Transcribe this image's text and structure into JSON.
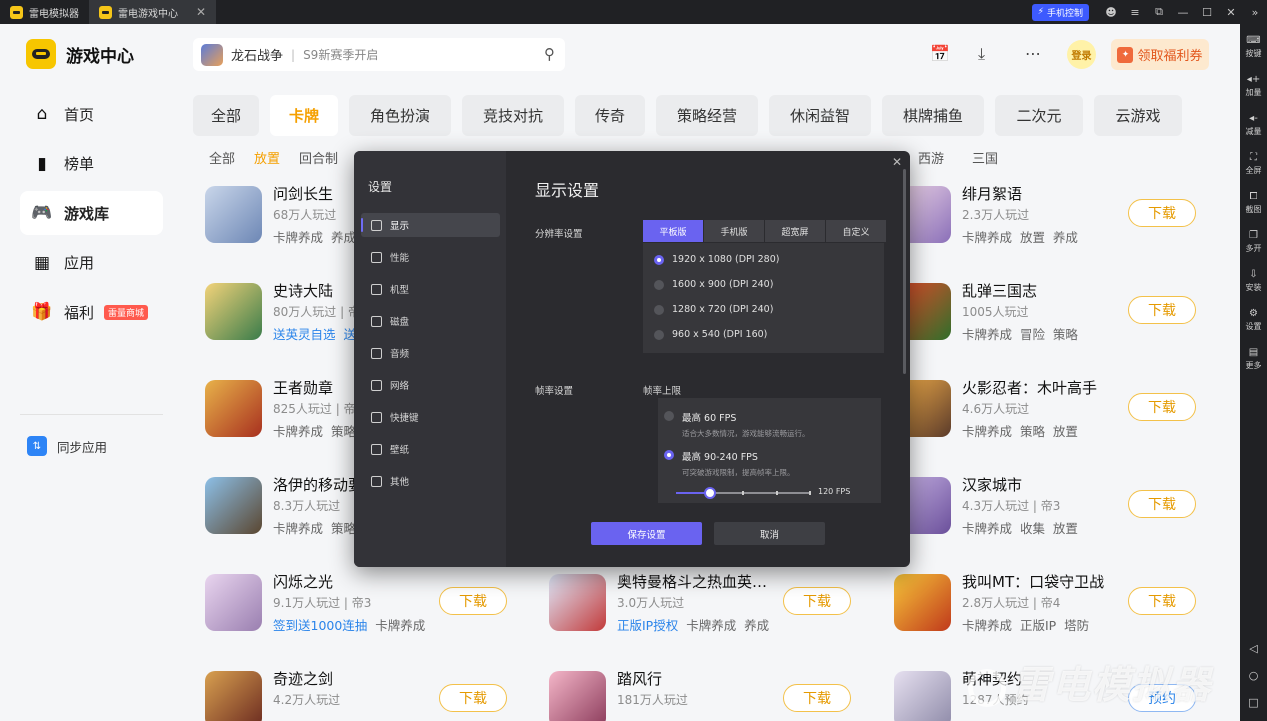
{
  "titlebar": {
    "tabs": [
      {
        "label": "雷电模拟器",
        "active": false
      },
      {
        "label": "雷电游戏中心",
        "active": true
      }
    ],
    "phone_control": "手机控制",
    "close_symbol": "✕"
  },
  "righttool": {
    "items": [
      {
        "icon": "keyboard-icon",
        "label": "按键"
      },
      {
        "icon": "volume-up-icon",
        "label": "加量"
      },
      {
        "icon": "volume-down-icon",
        "label": "减量"
      },
      {
        "icon": "fullscreen-icon",
        "label": "全屏"
      },
      {
        "icon": "screenshot-icon",
        "label": "截图"
      },
      {
        "icon": "multi-instance-icon",
        "label": "多开"
      },
      {
        "icon": "install-icon",
        "label": "安装"
      },
      {
        "icon": "settings-icon",
        "label": "设置"
      },
      {
        "icon": "more-icon",
        "label": "更多"
      }
    ]
  },
  "sidebar": {
    "brand": "游戏中心",
    "items": [
      {
        "label": "首页",
        "icon": "home-icon"
      },
      {
        "label": "榜单",
        "icon": "chart-icon"
      },
      {
        "label": "游戏库",
        "icon": "gamepad-icon",
        "active": true
      },
      {
        "label": "应用",
        "icon": "apps-icon"
      },
      {
        "label": "福利",
        "icon": "gift-icon",
        "badge": "雷量商城"
      }
    ],
    "sync": "同步应用"
  },
  "header": {
    "search_game": "龙石战争",
    "search_sub": "S9新赛季开启",
    "login": "登录",
    "coupon": "领取福利券"
  },
  "categories": [
    {
      "label": "全部",
      "w": 66
    },
    {
      "label": "卡牌",
      "w": 68,
      "active": true
    },
    {
      "label": "角色扮演",
      "w": 102
    },
    {
      "label": "竞技对抗",
      "w": 102
    },
    {
      "label": "传奇",
      "w": 70
    },
    {
      "label": "策略经营",
      "w": 102
    },
    {
      "label": "休闲益智",
      "w": 102
    },
    {
      "label": "棋牌捕鱼",
      "w": 102
    },
    {
      "label": "二次元",
      "w": 88
    },
    {
      "label": "云游戏",
      "w": 88
    }
  ],
  "subcategories": [
    "全部",
    "放置",
    "回合制"
  ],
  "subcategories_right": [
    "西游",
    "三国"
  ],
  "games": [
    {
      "name": "问剑长生",
      "meta": "68万人玩过",
      "tags": "卡牌养成  养成",
      "col": 0,
      "row": 0,
      "btn": "",
      "c1": "#c9d6ea",
      "c2": "#6d87b5"
    },
    {
      "name": "史诗大陆",
      "meta": "80万人玩过 | 帝",
      "tags": "送英灵自选  送",
      "promo": true,
      "col": 0,
      "row": 1,
      "btn": "",
      "c1": "#f3d37a",
      "c2": "#3a7c4a"
    },
    {
      "name": "王者勋章",
      "meta": "825人玩过 | 帝",
      "tags": "卡牌养成  策略",
      "col": 0,
      "row": 2,
      "btn": "",
      "c1": "#e8b24a",
      "c2": "#a8301f"
    },
    {
      "name": "洛伊的移动要",
      "meta": "8.3万人玩过",
      "tags": "卡牌养成  策略",
      "col": 0,
      "row": 3,
      "btn": "",
      "c1": "#8dc0e8",
      "c2": "#5a4630"
    },
    {
      "name": "闪烁之光",
      "meta": "9.1万人玩过 | 帝3",
      "tags_promo": "签到送1000连抽",
      "tags": "卡牌养成",
      "col": 0,
      "row": 4,
      "btn": "下载",
      "c1": "#e9d5ef",
      "c2": "#9a7fb0"
    },
    {
      "name": "奇迹之剑",
      "meta": "4.2万人玩过",
      "tags": "",
      "col": 0,
      "row": 5,
      "btn": "下载",
      "c1": "#d8a050",
      "c2": "#6b2a20"
    },
    {
      "name": "奥特曼格斗之热血英…",
      "meta": "3.0万人玩过",
      "tags_promo": "正版IP授权",
      "tags": "卡牌养成  养成",
      "col": 1,
      "row": 4,
      "btn": "下载",
      "c1": "#dfe9fb",
      "c2": "#c23a3a"
    },
    {
      "name": "踏风行",
      "meta": "181万人玩过",
      "tags": "",
      "col": 1,
      "row": 5,
      "btn": "下载",
      "c1": "#f4b6c8",
      "c2": "#8b3b5b"
    },
    {
      "name": "绯月絮语",
      "meta": "2.3万人玩过",
      "tags": "卡牌养成  放置  养成",
      "col": 2,
      "row": 0,
      "btn": "下载",
      "c1": "#f0d8e8",
      "c2": "#8a6fb8"
    },
    {
      "name": "乱弹三国志",
      "meta": "1005人玩过",
      "tags": "卡牌养成  冒险  策略",
      "col": 2,
      "row": 1,
      "btn": "下载",
      "c1": "#e84a2a",
      "c2": "#2f6e2a"
    },
    {
      "name": "火影忍者：木叶高手",
      "meta": "4.6万人玩过",
      "tags": "卡牌养成  策略  放置",
      "col": 2,
      "row": 2,
      "btn": "下载",
      "c1": "#f5b04a",
      "c2": "#5a3a2a"
    },
    {
      "name": "汉家城市",
      "meta": "4.3万人玩过 | 帝3",
      "tags": "卡牌养成  收集  放置",
      "col": 2,
      "row": 3,
      "btn": "下载",
      "c1": "#c9b5e6",
      "c2": "#6a4f9a"
    },
    {
      "name": "我叫MT：口袋守卫战",
      "meta": "2.8万人玩过 | 帝4",
      "tags": "卡牌养成  正版IP  塔防",
      "col": 2,
      "row": 4,
      "btn": "下载",
      "c1": "#f7c63a",
      "c2": "#c0391b"
    },
    {
      "name": "萌神契约",
      "meta": "1287人预约",
      "tags": "",
      "col": 2,
      "row": 5,
      "btn": "预约",
      "c1": "#e6e0f0",
      "c2": "#8e8aa8"
    }
  ],
  "watermark": "雷电模拟器",
  "modal": {
    "title": "设置",
    "heading": "显示设置",
    "nav": [
      {
        "label": "显示",
        "icon": "display-icon",
        "active": true
      },
      {
        "label": "性能",
        "icon": "performance-icon"
      },
      {
        "label": "机型",
        "icon": "device-model-icon"
      },
      {
        "label": "磁盘",
        "icon": "disk-icon"
      },
      {
        "label": "音频",
        "icon": "audio-icon"
      },
      {
        "label": "网络",
        "icon": "network-icon"
      },
      {
        "label": "快捷键",
        "icon": "shortcut-icon"
      },
      {
        "label": "壁纸",
        "icon": "wallpaper-icon"
      },
      {
        "label": "其他",
        "icon": "other-icon"
      }
    ],
    "resolution_label": "分辨率设置",
    "resolution_tabs": [
      {
        "label": "平板版",
        "active": true
      },
      {
        "label": "手机版"
      },
      {
        "label": "超宽屏"
      },
      {
        "label": "自定义"
      }
    ],
    "resolutions": [
      {
        "label": "1920 x 1080  (DPI 280)",
        "selected": true
      },
      {
        "label": "1600 x 900  (DPI 240)"
      },
      {
        "label": "1280 x 720  (DPI 240)"
      },
      {
        "label": "960 x 540  (DPI 160)"
      }
    ],
    "fps_label": "帧率设置",
    "fps_sub_label": "帧率上限",
    "fps_options": [
      {
        "title": "最高 60 FPS",
        "desc": "适合大多数情况，游戏能够流畅运行。",
        "selected": false
      },
      {
        "title": "最高 90-240 FPS",
        "desc": "可突破游戏限制，提高帧率上限。",
        "selected": true
      }
    ],
    "fps_slider_value": "120 FPS",
    "fps_slider_fraction": 0.25,
    "save": "保存设置",
    "cancel": "取消"
  }
}
